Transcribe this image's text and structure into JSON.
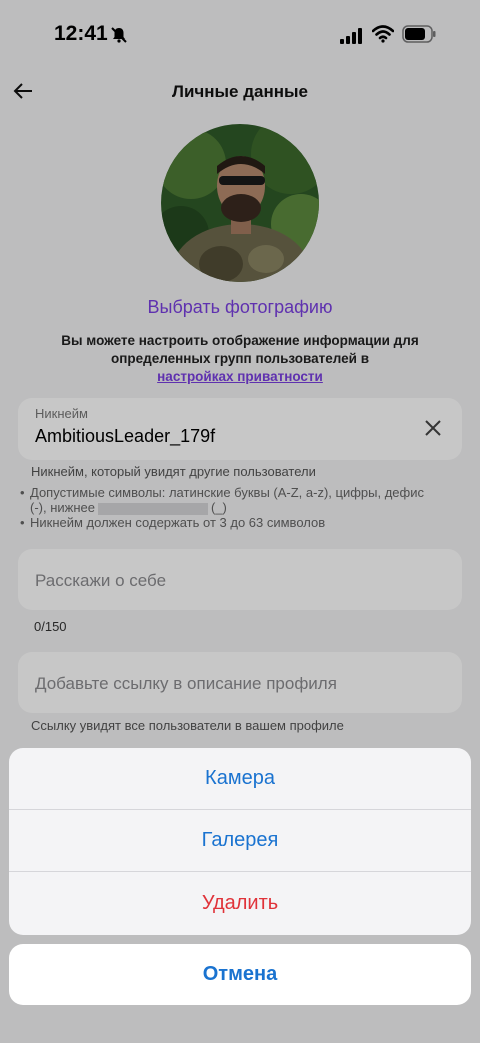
{
  "status_bar": {
    "time": "12:41",
    "icons": [
      "bell-off-icon",
      "signal-icon",
      "wifi-icon",
      "battery-icon"
    ]
  },
  "nav": {
    "title": "Личные данные",
    "back_icon": "arrow-left-icon"
  },
  "profile": {
    "choose_photo": "Выбрать фотографию",
    "privacy_text": "Вы можете настроить отображение информации для определенных групп пользователей в",
    "privacy_link": "настройках приватности"
  },
  "nickname": {
    "label": "Никнейм",
    "value": "AmbitiousLeader_179f",
    "hint": "Никнейм, который увидят другие пользователи",
    "rule_chars_prefix": "Допустимые символы: латинские буквы (A-Z, a-z), цифры, дефис (-), нижнее",
    "rule_chars_suffix": "(_)",
    "rule_length": "Никнейм должен содержать от 3 до 63 символов"
  },
  "about": {
    "placeholder": "Расскажи о себе",
    "counter": "0/150"
  },
  "link": {
    "placeholder": "Добавьте ссылку в описание профиля",
    "hint": "Ссылку увидят все пользователи в вашем профиле"
  },
  "action_sheet": {
    "camera": "Камера",
    "gallery": "Галерея",
    "delete": "Удалить",
    "cancel": "Отмена"
  },
  "colors": {
    "accent": "#7a3fe0",
    "action_blue": "#1a73d0",
    "danger": "#e0333a"
  }
}
